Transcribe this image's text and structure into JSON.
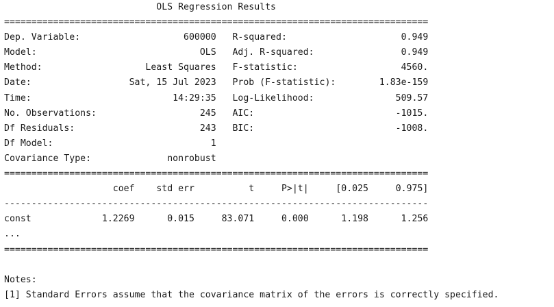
{
  "summary": {
    "title": "OLS Regression Results",
    "double_rule": "==============================================================================",
    "single_rule": "------------------------------------------------------------------------------",
    "model_info_left": [
      {
        "label": "Dep. Variable:",
        "value": "600000"
      },
      {
        "label": "Model:",
        "value": "OLS"
      },
      {
        "label": "Method:",
        "value": "Least Squares"
      },
      {
        "label": "Date:",
        "value": "Sat, 15 Jul 2023"
      },
      {
        "label": "Time:",
        "value": "14:29:35"
      },
      {
        "label": "No. Observations:",
        "value": "245"
      },
      {
        "label": "Df Residuals:",
        "value": "243"
      },
      {
        "label": "Df Model:",
        "value": "1"
      },
      {
        "label": "Covariance Type:",
        "value": "nonrobust"
      }
    ],
    "model_info_right": [
      {
        "label": "R-squared:",
        "value": "0.949"
      },
      {
        "label": "Adj. R-squared:",
        "value": "0.949"
      },
      {
        "label": "F-statistic:",
        "value": "4560."
      },
      {
        "label": "Prob (F-statistic):",
        "value": "1.83e-159"
      },
      {
        "label": "Log-Likelihood:",
        "value": "509.57"
      },
      {
        "label": "AIC:",
        "value": "-1015."
      },
      {
        "label": "BIC:",
        "value": "-1008."
      }
    ],
    "coef_headers": [
      "coef",
      "std err",
      "t",
      "P>|t|",
      "[0.025",
      "0.975]"
    ],
    "coef_rows": [
      {
        "name": "const",
        "values": [
          "1.2269",
          "0.015",
          "83.071",
          "0.000",
          "1.198",
          "1.256"
        ]
      }
    ],
    "ellipsis": "...",
    "notes_heading": "Notes:",
    "notes": [
      "[1] Standard Errors assume that the covariance matrix of the errors is correctly specified."
    ]
  }
}
